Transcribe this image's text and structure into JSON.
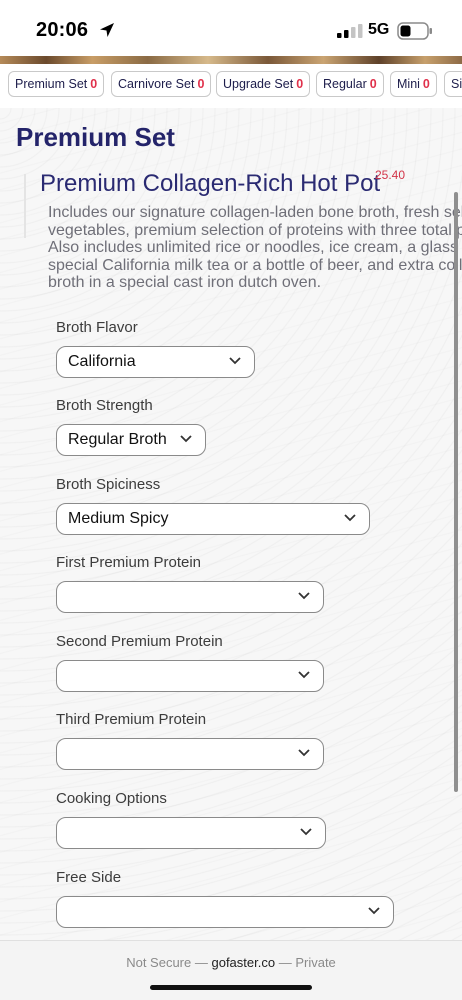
{
  "status_bar": {
    "time": "20:06",
    "network": "5G",
    "location_icon": "location-arrow-icon",
    "signal_icon": "cellular-signal-icon",
    "battery_icon": "battery-icon"
  },
  "tabs": [
    {
      "label": "Premium Set",
      "count": "0"
    },
    {
      "label": "Carnivore Set",
      "count": "0"
    },
    {
      "label": "Upgrade Set",
      "count": "0"
    },
    {
      "label": "Regular",
      "count": "0"
    },
    {
      "label": "Mini",
      "count": "0"
    },
    {
      "label": "Sid",
      "count": ""
    }
  ],
  "section": {
    "title": "Premium Set"
  },
  "item": {
    "title": "Premium Collagen-Rich Hot Pot",
    "price": "25.40",
    "description_lines": [
      "Includes our signature collagen-laden bone broth, fresh selection of",
      "vegetables, premium selection of proteins with three total proteins.",
      "Also includes unlimited rice or noodles, ice cream, a glass of our",
      "special California milk tea or a bottle of beer, and extra collagen",
      "broth in a special cast iron dutch oven."
    ]
  },
  "options": [
    {
      "label": "Broth Flavor",
      "value": "California"
    },
    {
      "label": "Broth Strength",
      "value": "Regular Broth"
    },
    {
      "label": "Broth Spiciness",
      "value": "Medium Spicy"
    },
    {
      "label": "First Premium Protein",
      "value": ""
    },
    {
      "label": "Second Premium Protein",
      "value": ""
    },
    {
      "label": "Third Premium Protein",
      "value": ""
    },
    {
      "label": "Cooking Options",
      "value": ""
    },
    {
      "label": "Free Side",
      "value": ""
    }
  ],
  "address_bar": {
    "prefix": "Not Secure —",
    "domain": "gofaster.co",
    "suffix": "— Private"
  },
  "colors": {
    "heading": "#24246a",
    "price": "#d23448",
    "count": "#e0314b"
  }
}
